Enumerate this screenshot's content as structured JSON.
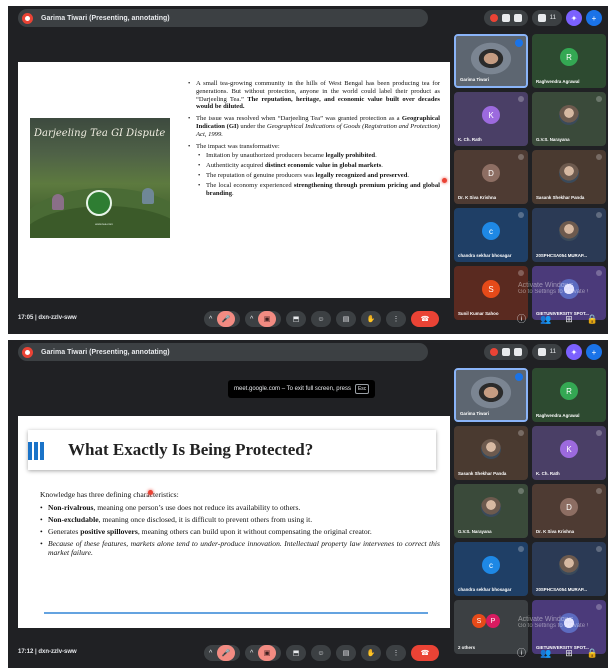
{
  "presenter_bar": "Garima Tiwari (Presenting, annotating)",
  "people_count": "11",
  "meeting": {
    "code": "dxn-zzlv-sww",
    "time_first": "17:05",
    "time_second": "17:12"
  },
  "fullscreen_toast": {
    "text": "meet.google.com – To exit full screen, press",
    "key": "Esc"
  },
  "controls": {
    "hand_icon": "✋",
    "more_icon": "⋮",
    "chevron": "^",
    "info_icon": "ⓘ",
    "people_icon": "👥",
    "activities_icon": "⊞",
    "host_icon": "🔒"
  },
  "slide1": {
    "image_title": "Darjeeling Tea GI Dispute",
    "image_caption": "www.tea.com",
    "bullet1_a": "A small tea-growing community in the hills of West Bengal has been producing tea for generations. But without protection, anyone in the world could label their product as “Darjeeling Tea.” ",
    "bullet1_b": "The reputation, heritage, and economic value built over decades would be diluted.",
    "bullet2_a": "The issue was resolved when “Darjeeling Tea” was granted protection as a ",
    "bullet2_b": "Geographical Indication (GI)",
    "bullet2_c": " under the ",
    "bullet2_d": "Geographical Indications of Goods (Registration and Protection) Act, 1999.",
    "bullet3": "The impact was transformative:",
    "sub1_a": "Imitation by unauthorized producers became ",
    "sub1_b": "legally prohibited",
    "sub1_c": ".",
    "sub2_a": "Authenticity acquired ",
    "sub2_b": "distinct economic value in global markets",
    "sub2_c": ".",
    "sub3_a": "The reputation of genuine producers was ",
    "sub3_b": "legally recognized and preserved",
    "sub3_c": ".",
    "sub4_a": "The local economy experienced ",
    "sub4_b": "strengthening through premium pricing and global branding",
    "sub4_c": "."
  },
  "slide2": {
    "title": "What Exactly Is Being Protected?",
    "intro": "Knowledge has three defining characteristics:",
    "b1_bold": "Non-rivalrous",
    "b1_rest": ", meaning one person’s use does not reduce its availability to others.",
    "b2_bold": "Non-excludable",
    "b2_rest": ", meaning once disclosed, it is difficult to prevent others from using it.",
    "b3_a": "Generates ",
    "b3_bold": "positive spillovers",
    "b3_rest": ", meaning others can build upon it without compensating the original creator.",
    "b4": "Because of these features, markets alone tend to under-produce innovation. Intellectual property law intervenes to correct this market failure."
  },
  "tiles_first": [
    {
      "name": "Garima Tiwari",
      "letter": "",
      "color": "#5f6368"
    },
    {
      "name": "Raghvendra Agrawal",
      "letter": "R",
      "color": "#34a853"
    },
    {
      "name": "K. Ch. Rath",
      "letter": "K",
      "color": "#9c6ade"
    },
    {
      "name": "G.V.S. Narayana",
      "letter": "",
      "color": "#6b8e6b"
    },
    {
      "name": "Dr. K Siva Krishna",
      "letter": "D",
      "color": "#8d6e63"
    },
    {
      "name": "Sasank Shekhar Panda",
      "letter": "",
      "color": "#9c7a64"
    },
    {
      "name": "chandra sekhar bhosagar",
      "letter": "c",
      "color": "#1e88e5"
    },
    {
      "name": "20SPHCSA054 MURAP...",
      "letter": "",
      "color": "#5a6f8c"
    },
    {
      "name": "Sunil Kumar Sahoo",
      "letter": "S",
      "color": "#e64a19"
    },
    {
      "name": "GIETUNIVERSITY SPOT...",
      "letter": "",
      "color": "#7e57c2"
    }
  ],
  "tiles_second": [
    {
      "name": "Garima Tiwari",
      "letter": "",
      "color": "#5f6368"
    },
    {
      "name": "Raghvendra Agrawal",
      "letter": "R",
      "color": "#34a853"
    },
    {
      "name": "Sasank Shekhar Panda",
      "letter": "",
      "color": "#9c7a64"
    },
    {
      "name": "K. Ch. Rath",
      "letter": "K",
      "color": "#9c6ade"
    },
    {
      "name": "G.V.S. Narayana",
      "letter": "",
      "color": "#6b8e6b"
    },
    {
      "name": "Dr. K Siva Krishna",
      "letter": "D",
      "color": "#8d6e63"
    },
    {
      "name": "chandra sekhar bhosagar",
      "letter": "c",
      "color": "#1e88e5"
    },
    {
      "name": "20SPHCSA054 MURAP...",
      "letter": "",
      "color": "#5a6f8c"
    },
    {
      "name": "2 others",
      "letter": "",
      "color": "#3c4043"
    },
    {
      "name": "GIETUNIVERSITY SPOT...",
      "letter": "",
      "color": "#7e57c2"
    }
  ],
  "others_avatars": [
    "S",
    "P"
  ],
  "watermark": {
    "line1": "Activate Windows",
    "line2": "Go to Settings to activate Windows."
  }
}
